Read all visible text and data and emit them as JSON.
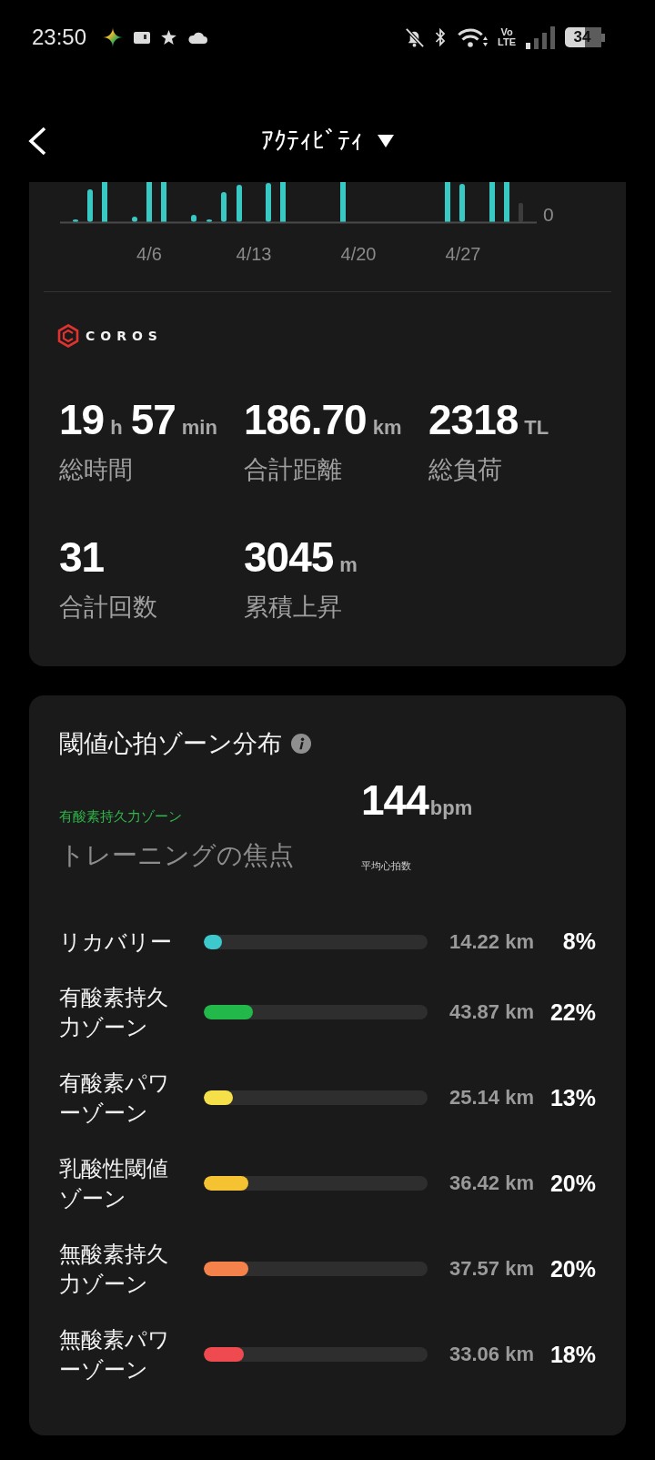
{
  "status_bar": {
    "time": "23:50",
    "network_label": "Vo LTE",
    "battery": "34"
  },
  "header": {
    "title": "ｱｸﾃｨﾋﾞﾃｨ"
  },
  "activity_chart": {
    "axis_label": "0",
    "date_labels": [
      "4/6",
      "4/13",
      "4/20",
      "4/27"
    ]
  },
  "summary": {
    "brand": "COROS",
    "stats": [
      {
        "parts": [
          {
            "value": "19",
            "unit": "h"
          },
          {
            "value": "57",
            "unit": "min"
          }
        ],
        "label": "総時間"
      },
      {
        "parts": [
          {
            "value": "186.70",
            "unit": "km"
          }
        ],
        "label": "合計距離"
      },
      {
        "parts": [
          {
            "value": "2318",
            "unit": "TL"
          }
        ],
        "label": "総負荷"
      },
      {
        "parts": [
          {
            "value": "31"
          }
        ],
        "label": "合計回数"
      },
      {
        "parts": [
          {
            "value": "3045",
            "unit": "m"
          }
        ],
        "label": "累積上昇"
      }
    ]
  },
  "zones": {
    "title": "閾値心拍ゾーン分布",
    "focus_zone": "有酸素持久力ゾーン",
    "focus_label": "トレーニングの焦点",
    "avg_hr": {
      "value": "144",
      "unit": "bpm",
      "label": "平均心拍数"
    },
    "rows": [
      {
        "name": "リカバリー",
        "color": "#3cc8cc",
        "level": 0.08,
        "distance": "14.22 km",
        "percent": "8%"
      },
      {
        "name": "有酸素持久力ゾーン",
        "color": "#22b84a",
        "level": 0.22,
        "distance": "43.87 km",
        "percent": "22%"
      },
      {
        "name": "有酸素パワーゾーン",
        "color": "#f5e04a",
        "level": 0.13,
        "distance": "25.14 km",
        "percent": "13%"
      },
      {
        "name": "乳酸性閾値ゾーン",
        "color": "#f5c232",
        "level": 0.2,
        "distance": "36.42 km",
        "percent": "20%"
      },
      {
        "name": "無酸素持久力ゾーン",
        "color": "#f5824a",
        "level": 0.2,
        "distance": "37.57 km",
        "percent": "20%"
      },
      {
        "name": "無酸素パワーゾーン",
        "color": "#ef4a50",
        "level": 0.18,
        "distance": "33.06 km",
        "percent": "18%"
      }
    ]
  }
}
